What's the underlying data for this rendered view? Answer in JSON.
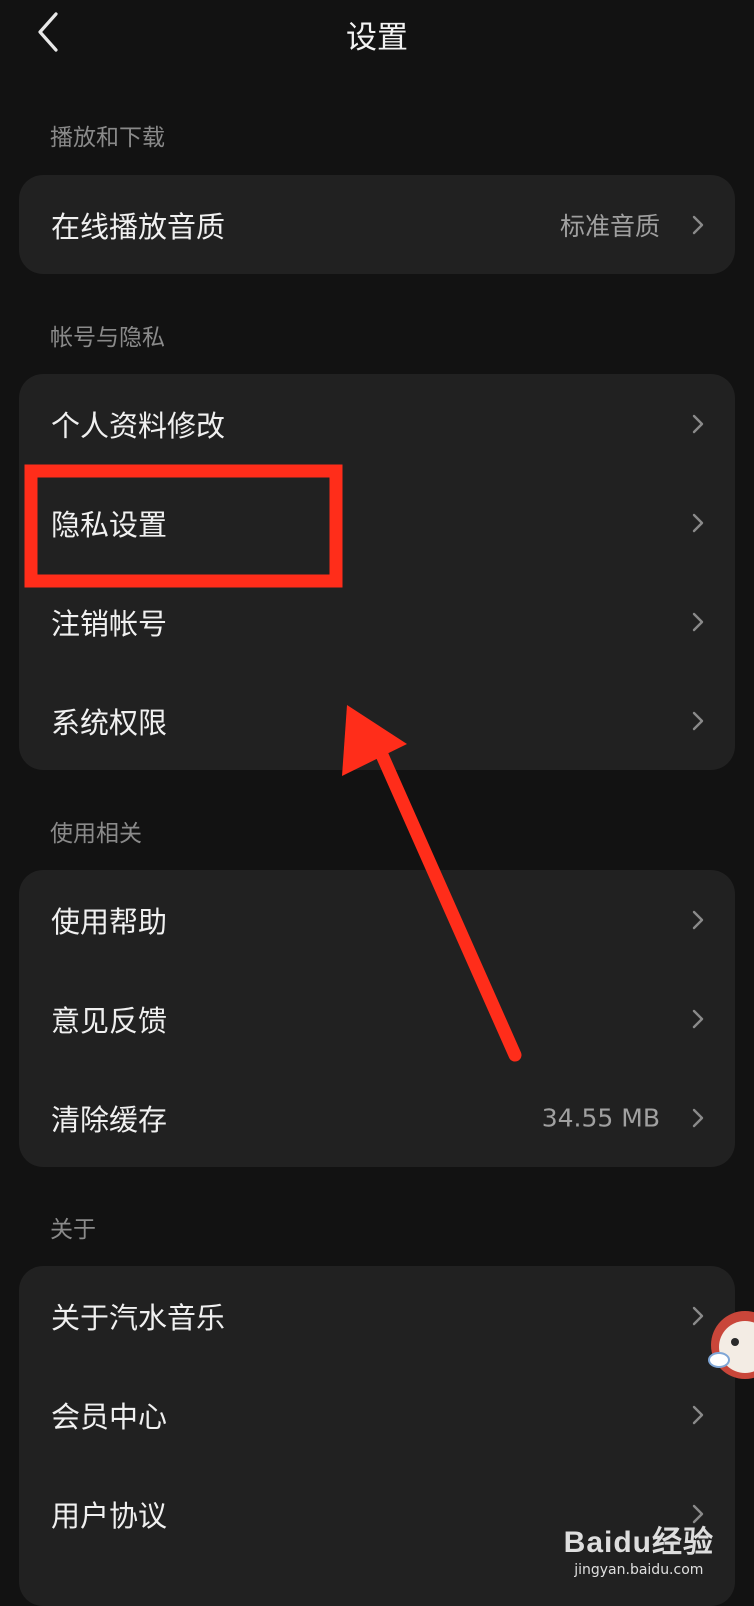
{
  "header": {
    "title": "设置"
  },
  "sections": [
    {
      "label": "播放和下载",
      "items": [
        {
          "label": "在线播放音质",
          "value": "标准音质"
        }
      ]
    },
    {
      "label": "帐号与隐私",
      "items": [
        {
          "label": "个人资料修改"
        },
        {
          "label": "隐私设置"
        },
        {
          "label": "注销帐号"
        },
        {
          "label": "系统权限"
        }
      ]
    },
    {
      "label": "使用相关",
      "items": [
        {
          "label": "使用帮助"
        },
        {
          "label": "意见反馈"
        },
        {
          "label": "清除缓存",
          "value": "34.55 MB"
        }
      ]
    },
    {
      "label": "关于",
      "items": [
        {
          "label": "关于汽水音乐"
        },
        {
          "label": "会员中心"
        },
        {
          "label": "用户协议"
        }
      ]
    }
  ],
  "watermark": {
    "logo": "Baidu经验",
    "url": "jingyan.baidu.com"
  },
  "colors": {
    "annotation": "#ff2d1a",
    "background": "#121212",
    "card": "#212121"
  },
  "icons": {
    "back": "chevron-left-icon",
    "row": "chevron-right-icon"
  }
}
